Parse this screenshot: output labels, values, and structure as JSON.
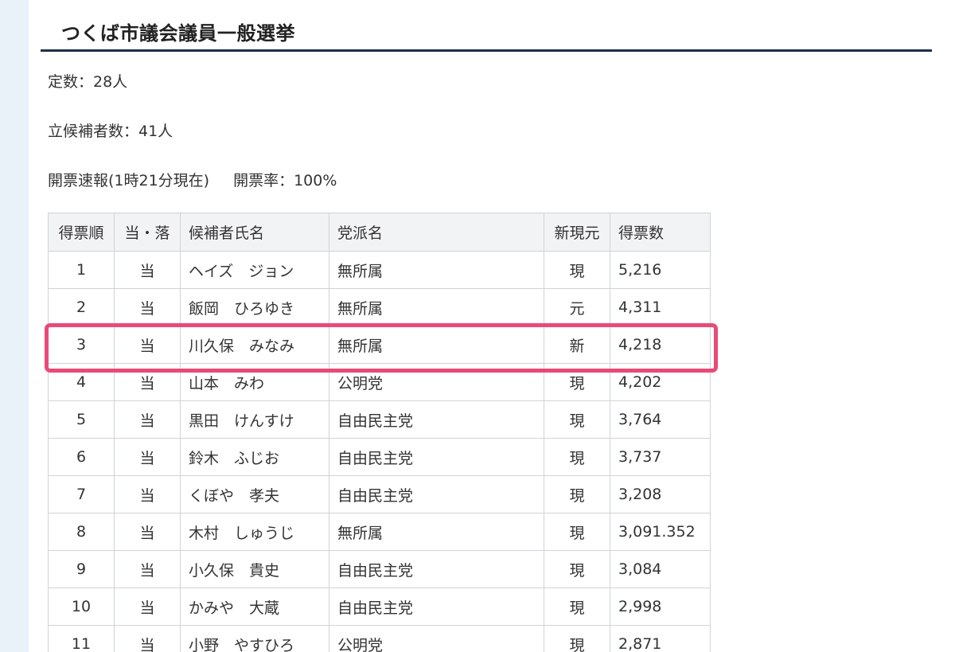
{
  "heading": "つくば市議会議員一般選挙",
  "info": {
    "seats": "定数：28人",
    "candidates": "立候補者数：41人",
    "count_status": "開票速報(1時21分現在)",
    "count_rate": "開票率：100%"
  },
  "table": {
    "headers": [
      "得票順",
      "当・落",
      "候補者氏名",
      "党派名",
      "新現元",
      "得票数"
    ],
    "rows": [
      {
        "rank": "1",
        "result": "当",
        "name": "ヘイズ　ジョン",
        "party": "無所属",
        "status": "現",
        "votes": "5,216"
      },
      {
        "rank": "2",
        "result": "当",
        "name": "飯岡　ひろゆき",
        "party": "無所属",
        "status": "元",
        "votes": "4,311"
      },
      {
        "rank": "3",
        "result": "当",
        "name": "川久保　みなみ",
        "party": "無所属",
        "status": "新",
        "votes": "4,218"
      },
      {
        "rank": "4",
        "result": "当",
        "name": "山本　みわ",
        "party": "公明党",
        "status": "現",
        "votes": "4,202"
      },
      {
        "rank": "5",
        "result": "当",
        "name": "黒田　けんすけ",
        "party": "自由民主党",
        "status": "現",
        "votes": "3,764"
      },
      {
        "rank": "6",
        "result": "当",
        "name": "鈴木　ふじお",
        "party": "自由民主党",
        "status": "現",
        "votes": "3,737"
      },
      {
        "rank": "7",
        "result": "当",
        "name": "くぼや　孝夫",
        "party": "自由民主党",
        "status": "現",
        "votes": "3,208"
      },
      {
        "rank": "8",
        "result": "当",
        "name": "木村　しゅうじ",
        "party": "無所属",
        "status": "現",
        "votes": "3,091.352"
      },
      {
        "rank": "9",
        "result": "当",
        "name": "小久保　貴史",
        "party": "自由民主党",
        "status": "現",
        "votes": "3,084"
      },
      {
        "rank": "10",
        "result": "当",
        "name": "かみや　大蔵",
        "party": "自由民主党",
        "status": "現",
        "votes": "2,998"
      },
      {
        "rank": "11",
        "result": "当",
        "name": "小野　やすひろ",
        "party": "公明党",
        "status": "現",
        "votes": "2,871"
      }
    ]
  },
  "colors": {
    "highlight": "#ea4a77",
    "heading_rule": "#1f3046",
    "page_background": "#e9f1f9",
    "header_background": "#f2f3f5"
  }
}
